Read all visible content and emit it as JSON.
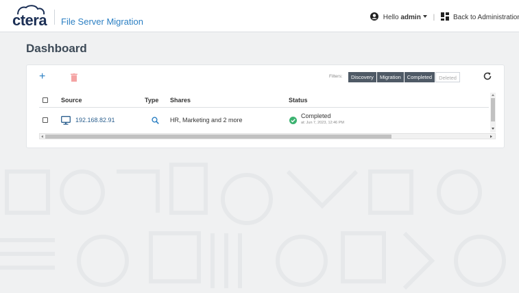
{
  "app": {
    "logo_text": "ctera",
    "title": "File Server Migration"
  },
  "header": {
    "greeting": "Hello ",
    "username": "admin",
    "separator": "|",
    "back_link": "Back to Administration"
  },
  "page": {
    "title": "Dashboard"
  },
  "toolbar": {
    "add_label": "+",
    "filters_label": "Filters:",
    "filters": [
      {
        "label": "Discovery",
        "active": true
      },
      {
        "label": "Migration",
        "active": true
      },
      {
        "label": "Completed",
        "active": true
      },
      {
        "label": "Deleted",
        "active": false
      }
    ]
  },
  "table": {
    "columns": [
      "Source",
      "Type",
      "Shares",
      "Status"
    ],
    "rows": [
      {
        "source": "192.168.82.91",
        "type_icon": "search-icon",
        "shares": "HR, Marketing and 2 more",
        "status": "Completed",
        "status_time": "at: Jun 7, 2023, 12:46 PM"
      }
    ]
  },
  "colors": {
    "accent": "#2b7fc3",
    "logo_dark": "#1b2f55",
    "filter_active": "#4f5a66",
    "success": "#3cb371",
    "delete": "#f08080"
  }
}
